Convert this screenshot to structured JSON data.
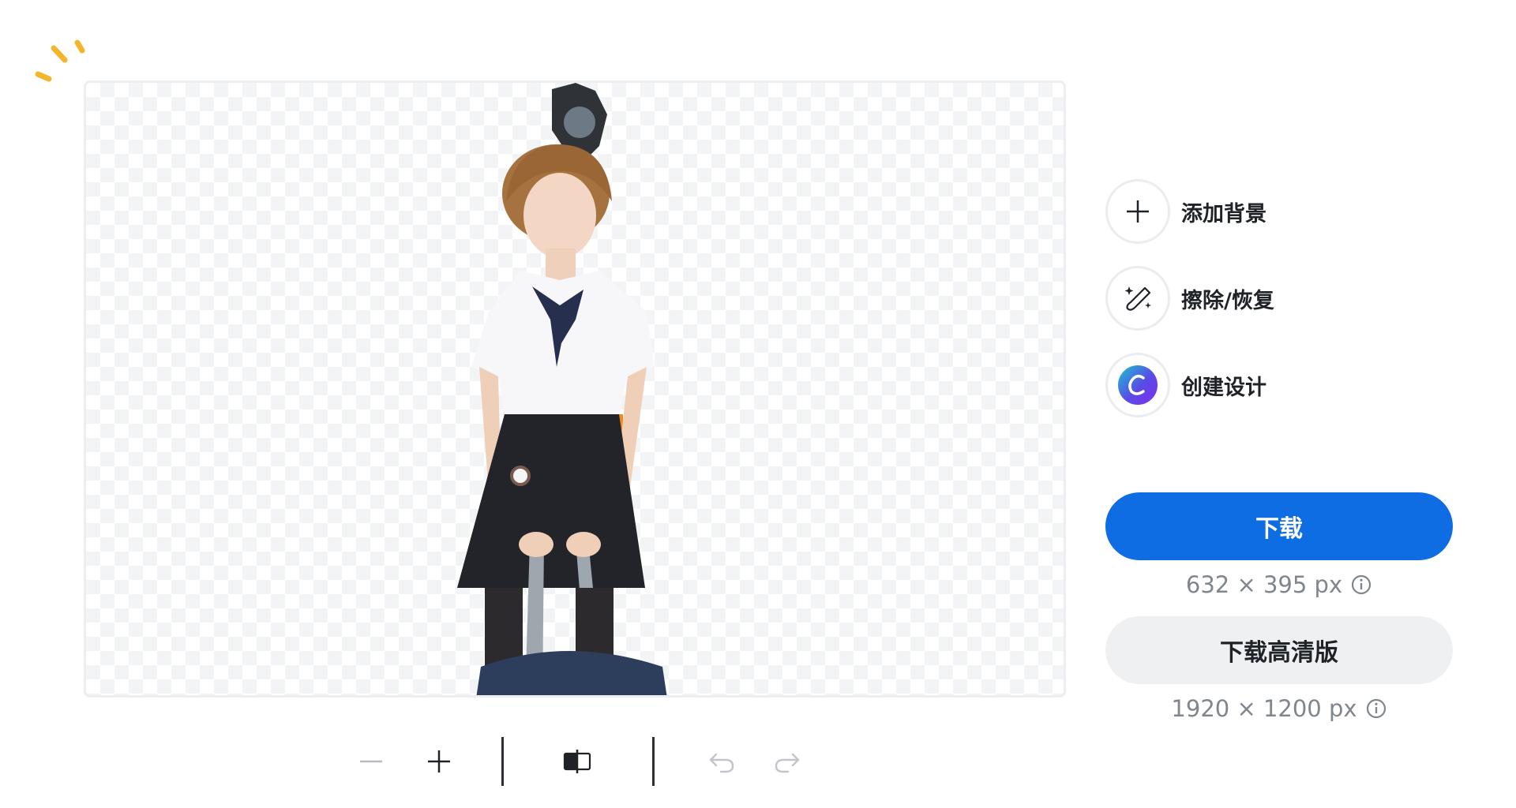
{
  "colors": {
    "accent": "#0f6de3",
    "secondary_bg": "#eff0f2",
    "text_dark": "#1f2328",
    "text_muted": "#80868e",
    "sparkle": "#f4b42c"
  },
  "icons": {
    "sparkle": "sparkle-decoration-icon",
    "add": "plus-icon",
    "erase": "magic-brush-icon",
    "design": "canva-logo-icon",
    "info": "info-icon",
    "zoom_out": "minus-icon",
    "zoom_in": "plus-icon",
    "compare": "compare-icon",
    "undo": "undo-icon",
    "redo": "redo-icon"
  },
  "side_actions": [
    {
      "label": "添加背景"
    },
    {
      "label": "擦除/恢复"
    },
    {
      "label": "创建设计"
    }
  ],
  "download": {
    "primary_label": "下载",
    "primary_size": "632 × 395 px",
    "hd_label": "下载高清版",
    "hd_size": "1920 × 1200 px"
  }
}
